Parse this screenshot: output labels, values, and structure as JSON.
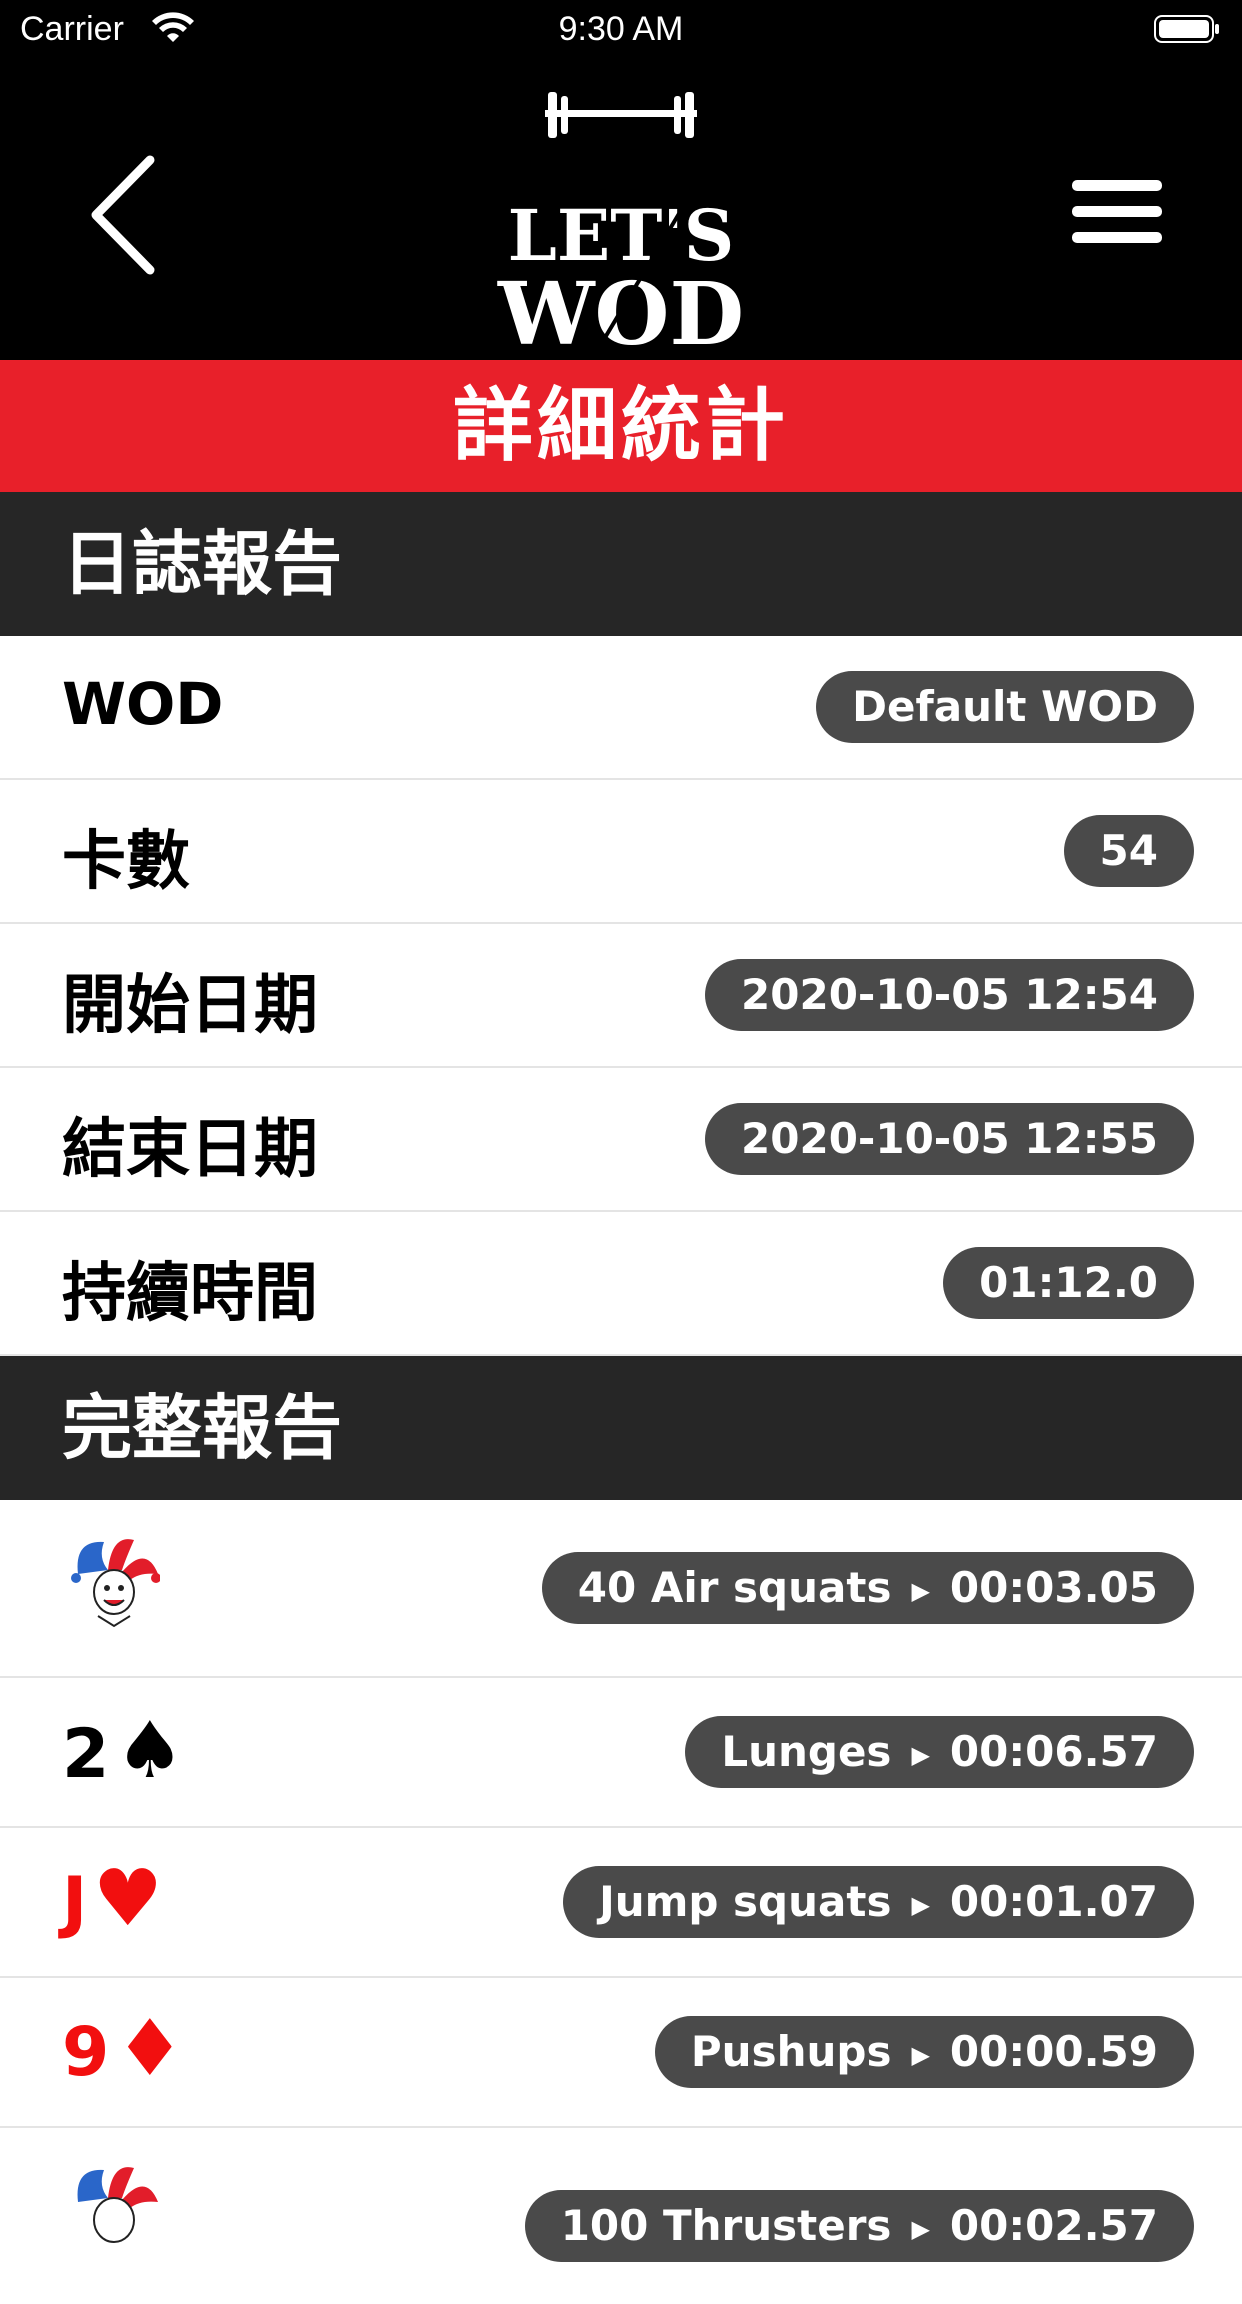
{
  "status_bar": {
    "carrier": "Carrier",
    "time": "9:30 AM"
  },
  "nav": {
    "logo_line1": "LET'S",
    "logo_line2": "WOD"
  },
  "banner": {
    "title": "詳細統計"
  },
  "log_section": {
    "title": "日誌報告",
    "rows": [
      {
        "label": "WOD",
        "value": "Default WOD"
      },
      {
        "label": "卡數",
        "value": "54"
      },
      {
        "label": "開始日期",
        "value": "2020-10-05 12:54"
      },
      {
        "label": "結束日期",
        "value": "2020-10-05 12:55"
      },
      {
        "label": "持續時間",
        "value": "01:12.0"
      }
    ]
  },
  "full_section": {
    "title": "完整報告",
    "rows": [
      {
        "card": "joker",
        "rank": "",
        "suit": "",
        "exercise": "40 Air squats",
        "time": "00:03.05"
      },
      {
        "card": "spade",
        "rank": "2",
        "suit": "♠",
        "exercise": "Lunges",
        "time": "00:06.57"
      },
      {
        "card": "heart",
        "rank": "J",
        "suit": "♥",
        "exercise": "Jump squats",
        "time": "00:01.07"
      },
      {
        "card": "diamond",
        "rank": "9",
        "suit": "♦",
        "exercise": "Pushups",
        "time": "00:00.59"
      },
      {
        "card": "joker",
        "rank": "",
        "suit": "",
        "exercise": "100 Thrusters",
        "time": "00:02.57"
      }
    ]
  },
  "colors": {
    "banner": "#e8202a",
    "section": "#262626",
    "pill": "#4a4a4a",
    "red_card": "#f20f0f"
  }
}
